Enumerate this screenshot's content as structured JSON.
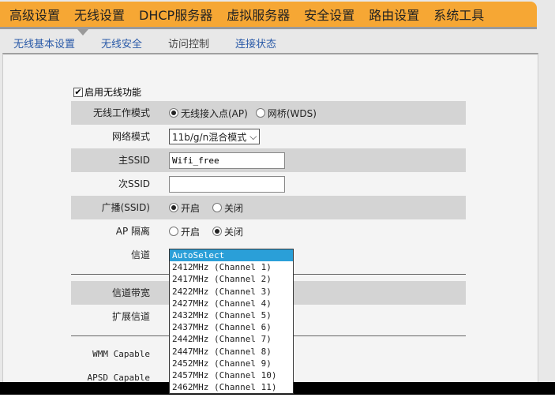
{
  "nav": [
    "高级设置",
    "无线设置",
    "DHCP服务器",
    "虚拟服务器",
    "安全设置",
    "路由设置",
    "系统工具"
  ],
  "subnav": [
    "无线基本设置",
    "无线安全",
    "访问控制",
    "连接状态"
  ],
  "enable_wireless": {
    "label": "启用无线功能",
    "checked": true
  },
  "rows": {
    "mode": {
      "label": "无线工作模式",
      "options": [
        "无线接入点(AP)",
        "网桥(WDS)"
      ],
      "selected": 0
    },
    "net_mode": {
      "label": "网络模式",
      "value": "11b/g/n混合模式"
    },
    "ssid1": {
      "label": "主SSID",
      "value": "Wifi_free"
    },
    "ssid2": {
      "label": "次SSID",
      "value": ""
    },
    "broadcast": {
      "label": "广播(SSID)",
      "options": [
        "开启",
        "关闭"
      ],
      "selected": 0
    },
    "ap_iso": {
      "label": "AP 隔离",
      "options": [
        "开启",
        "关闭"
      ],
      "selected": 1
    },
    "channel": {
      "label": "信道"
    },
    "bandwidth": {
      "label": "信道带宽"
    },
    "ext_channel": {
      "label": "扩展信道"
    },
    "wmm": {
      "label": "WMM Capable"
    },
    "apsd": {
      "label": "APSD Capable"
    }
  },
  "channel_options": [
    "AutoSelect",
    "2412MHz (Channel 1)",
    "2417MHz (Channel 2)",
    "2422MHz (Channel 3)",
    "2427MHz (Channel 4)",
    "2432MHz (Channel 5)",
    "2437MHz (Channel 6)",
    "2442MHz (Channel 7)",
    "2447MHz (Channel 8)",
    "2452MHz (Channel 9)",
    "2457MHz (Channel 10)",
    "2462MHz (Channel 11)"
  ],
  "colors": {
    "nav": "#f6a734",
    "highlight": "#2a9fd8"
  }
}
